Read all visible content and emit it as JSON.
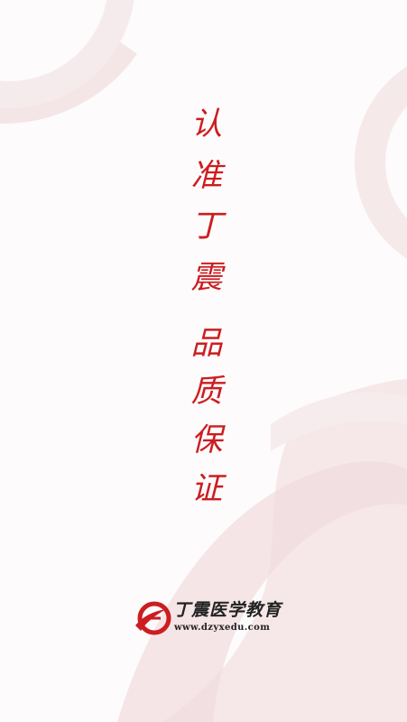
{
  "slogan": {
    "chars": [
      "认",
      "准",
      "丁",
      "震",
      "品",
      "质",
      "保",
      "证"
    ]
  },
  "brand": {
    "name": "丁震医学教育",
    "url": "www.dzyxedu.com",
    "logo_icon": "dz-logo-icon",
    "accent_color": "#cc1d20"
  }
}
